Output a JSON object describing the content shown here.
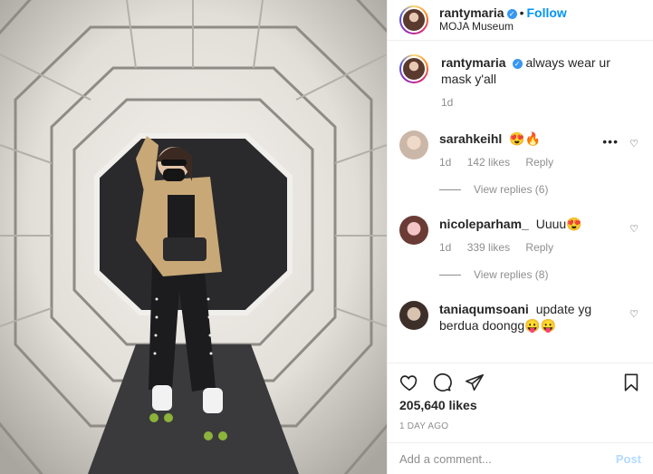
{
  "post": {
    "username": "rantymaria",
    "follow_label": "Follow",
    "location": "MOJA Museum",
    "caption": "always wear ur mask y'all",
    "caption_age": "1d",
    "likes": "205,640 likes",
    "date": "1 DAY AGO",
    "comment_placeholder": "Add a comment...",
    "post_label": "Post"
  },
  "comments": [
    {
      "username": "sarahkeihl",
      "text": "😍🔥",
      "age": "1d",
      "likes": "142 likes",
      "reply_label": "Reply",
      "view_replies": "View replies (6)"
    },
    {
      "username": "nicoleparham_",
      "text": "Uuuu😍",
      "age": "1d",
      "likes": "339 likes",
      "reply_label": "Reply",
      "view_replies": "View replies (8)"
    },
    {
      "username": "taniaqumsoani",
      "text": "update yg berdua doongg😛😛"
    }
  ],
  "colors": {
    "accent": "#0095f6",
    "verified": "#3897f0",
    "muted": "#8e8e8e"
  },
  "icons": [
    "verified-icon",
    "heart-icon",
    "comment-icon",
    "share-icon",
    "save-icon",
    "more-icon"
  ]
}
